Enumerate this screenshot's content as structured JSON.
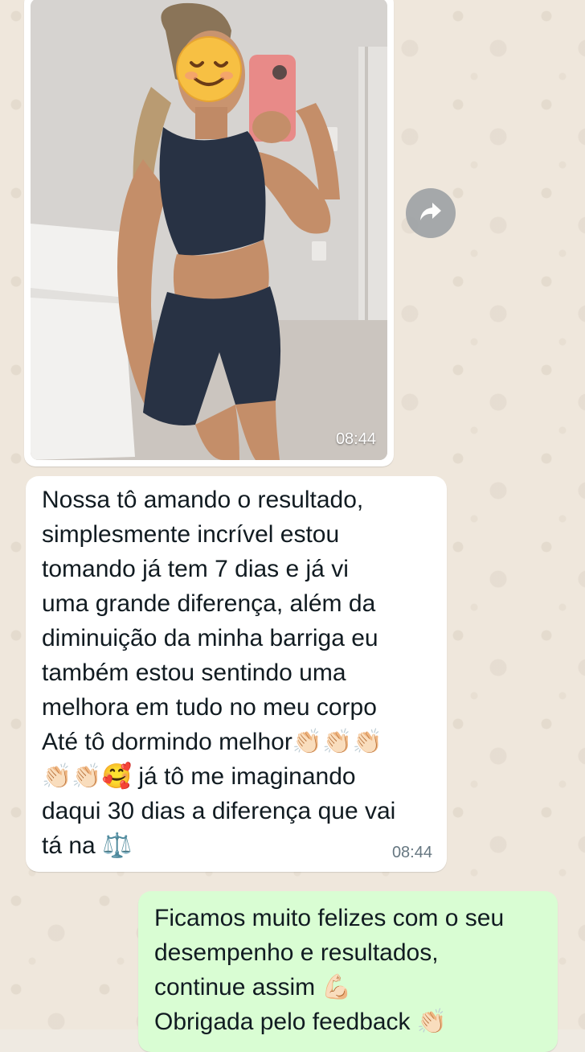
{
  "chat": {
    "messages": [
      {
        "type": "image",
        "direction": "incoming",
        "time": "08:44",
        "icon_sticker": "smiling-face-emoji",
        "forward_icon": "forward-arrow-icon"
      },
      {
        "type": "text",
        "direction": "incoming",
        "text": "Nossa tô amando o resultado,\nsimplesmente incrível estou\ntomando já tem 7 dias e já vi\numa grande diferença, além da\ndiminuição da minha barriga eu\ntambém estou sentindo uma\nmelhora em tudo no meu corpo\nAté tô dormindo melhor👏🏻👏🏻👏🏻\n👏🏻👏🏻🥰 já tô me imaginando\ndaqui 30 dias a diferença que vai\ntá na ⚖️",
        "time": "08:44"
      },
      {
        "type": "text",
        "direction": "outgoing",
        "text": "Ficamos muito felizes com o seu\ndesempenho e resultados,\ncontinue assim 💪🏻\nObrigada pelo feedback 👏🏻"
      }
    ]
  },
  "colors": {
    "incoming_bubble": "#ffffff",
    "outgoing_bubble": "#d9fdd3",
    "wallpaper": "#efe7dc",
    "timestamp": "#667781"
  }
}
